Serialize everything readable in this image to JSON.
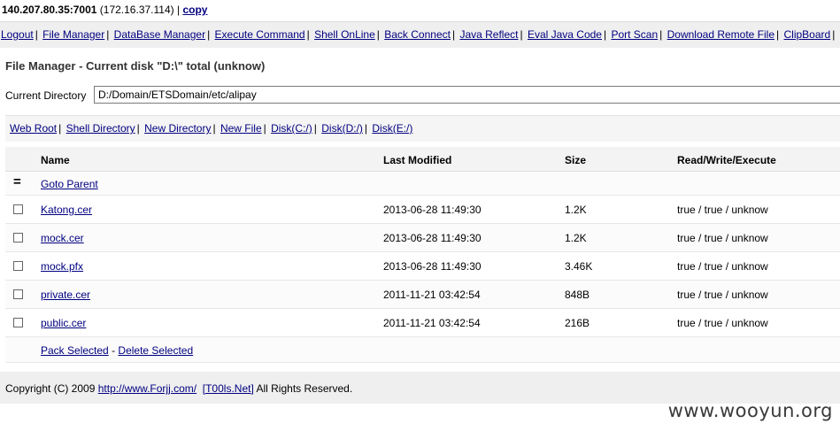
{
  "topbar": {
    "ip": "140.207.80.35:7001",
    "local_ip": "(172.16.37.114)",
    "separator": "|",
    "copy_label": "copy"
  },
  "nav": {
    "items": [
      "Logout",
      "File Manager",
      "DataBase Manager",
      "Execute Command",
      "Shell OnLine",
      "Back Connect",
      "Java Reflect",
      "Eval Java Code",
      "Port Scan",
      "Download Remote File",
      "ClipBoard"
    ]
  },
  "heading": "File Manager - Current disk \"D:\\\" total (unknow)",
  "current_directory": {
    "label": "Current Directory",
    "value": "D:/Domain/ETSDomain/etc/alipay"
  },
  "quick_links": [
    "Web Root",
    "Shell Directory",
    "New Directory",
    "New File",
    "Disk(C:/)",
    "Disk(D:/)",
    "Disk(E:/)"
  ],
  "table": {
    "headers": {
      "name": "Name",
      "modified": "Last Modified",
      "size": "Size",
      "rwx": "Read/Write/Execute"
    },
    "parent_icon": "=",
    "parent_label": "Goto Parent",
    "rows": [
      {
        "name": "Katong.cer",
        "modified": "2013-06-28 11:49:30",
        "size": "1.2K",
        "rwx": "true / true / unknow"
      },
      {
        "name": "mock.cer",
        "modified": "2013-06-28 11:49:30",
        "size": "1.2K",
        "rwx": "true / true / unknow"
      },
      {
        "name": "mock.pfx",
        "modified": "2013-06-28 11:49:30",
        "size": "3.46K",
        "rwx": "true / true / unknow"
      },
      {
        "name": "private.cer",
        "modified": "2011-11-21 03:42:54",
        "size": "848B",
        "rwx": "true / true / unknow"
      },
      {
        "name": "public.cer",
        "modified": "2011-11-21 03:42:54",
        "size": "216B",
        "rwx": "true / true / unknow"
      }
    ],
    "pack_label": "Pack Selected",
    "action_sep": "-",
    "delete_label": "Delete Selected"
  },
  "footer": {
    "copyright_prefix": "Copyright (C) 2009",
    "link1": "http://www.Forjj.com/",
    "link2": "[T00ls.Net]",
    "suffix": "All Rights Reserved."
  },
  "watermark": "www.wooyun.org"
}
